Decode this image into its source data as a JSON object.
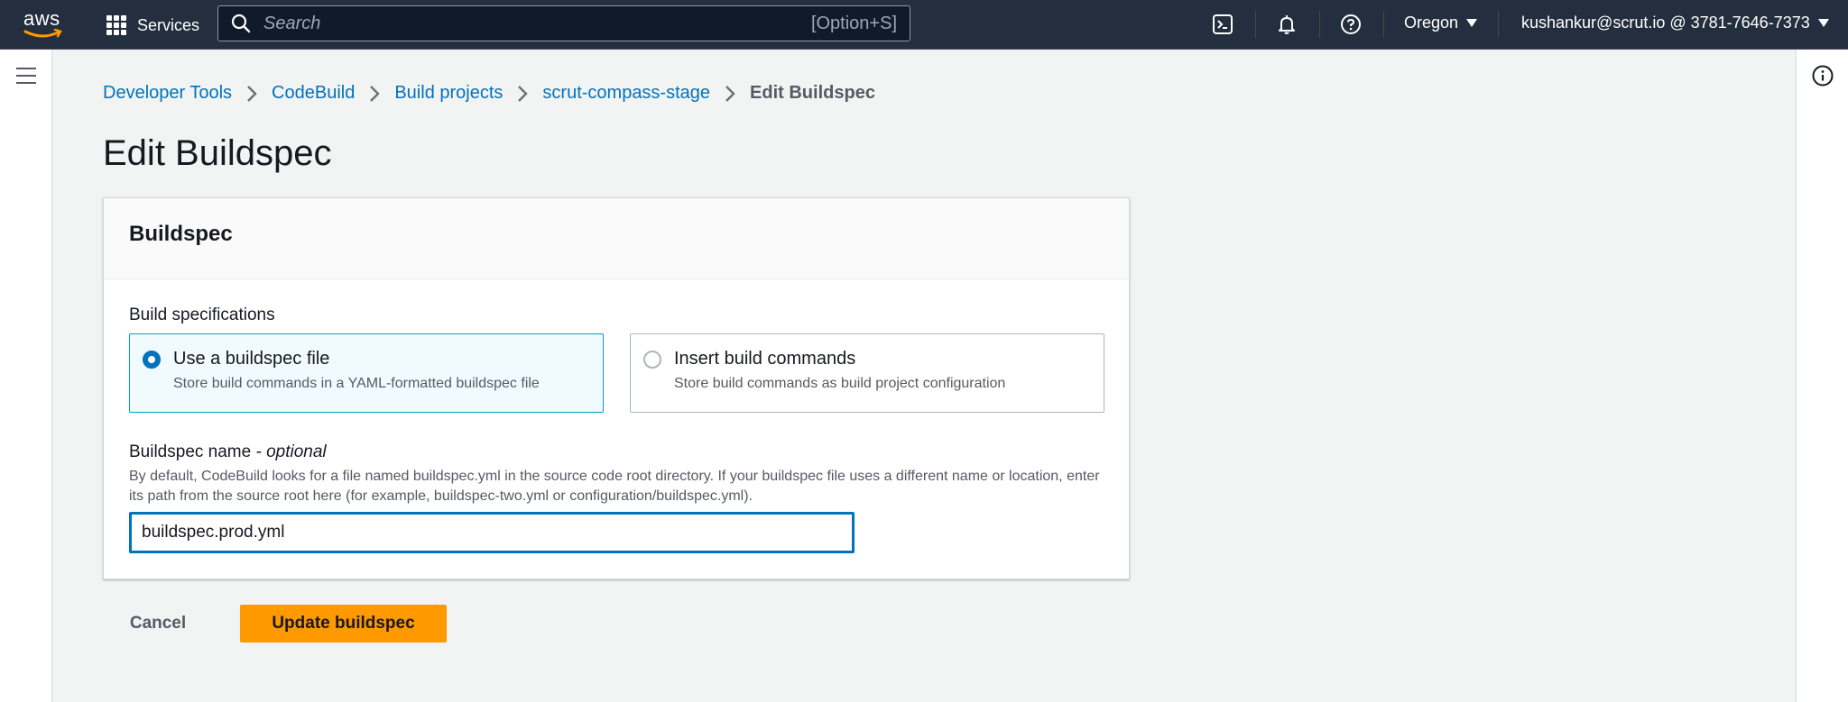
{
  "topnav": {
    "logo_text": "aws",
    "services_label": "Services",
    "search_placeholder": "Search",
    "search_shortcut": "[Option+S]",
    "region": "Oregon",
    "account": "kushankur@scrut.io @ 3781-7646-7373"
  },
  "breadcrumb": [
    "Developer Tools",
    "CodeBuild",
    "Build projects",
    "scrut-compass-stage",
    "Edit Buildspec"
  ],
  "page_title": "Edit Buildspec",
  "panel": {
    "heading": "Buildspec",
    "build_specs_label": "Build specifications",
    "options": [
      {
        "title": "Use a buildspec file",
        "description": "Store build commands in a YAML-formatted buildspec file",
        "selected": true
      },
      {
        "title": "Insert build commands",
        "description": "Store build commands as build project configuration",
        "selected": false
      }
    ],
    "name_label": "Buildspec name",
    "name_optional": "- optional",
    "name_description": "By default, CodeBuild looks for a file named buildspec.yml in the source code root directory. If your buildspec file uses a different name or location, enter its path from the source root here (for example, buildspec-two.yml or configuration/buildspec.yml).",
    "name_value": "buildspec.prod.yml"
  },
  "actions": {
    "cancel": "Cancel",
    "submit": "Update buildspec"
  },
  "colors": {
    "nav_bg": "#232f3e",
    "link": "#0073bb",
    "primary_button": "#ff9900",
    "selected_tile_border": "#00a1c9"
  }
}
